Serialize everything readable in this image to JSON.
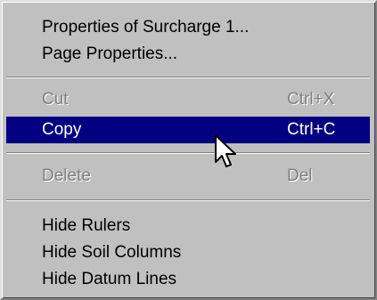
{
  "menu": {
    "items": [
      {
        "label": "Properties of  Surcharge 1...",
        "shortcut": "",
        "enabled": true
      },
      {
        "label": "Page Properties...",
        "shortcut": "",
        "enabled": true
      },
      {
        "label": "Cut",
        "shortcut": "Ctrl+X",
        "enabled": false
      },
      {
        "label": "Copy",
        "shortcut": "Ctrl+C",
        "enabled": true,
        "highlighted": true
      },
      {
        "label": "Delete",
        "shortcut": "Del",
        "enabled": false
      },
      {
        "label": "Hide Rulers",
        "shortcut": "",
        "enabled": true
      },
      {
        "label": "Hide Soil Columns",
        "shortcut": "",
        "enabled": true
      },
      {
        "label": "Hide Datum Lines",
        "shortcut": "",
        "enabled": true
      }
    ]
  },
  "colors": {
    "menu_background": "#c0c0c0",
    "highlight_background": "#000080",
    "highlight_text": "#ffffff",
    "disabled_text": "#808080"
  },
  "icons": {
    "cursor": "arrow-cursor-icon"
  }
}
